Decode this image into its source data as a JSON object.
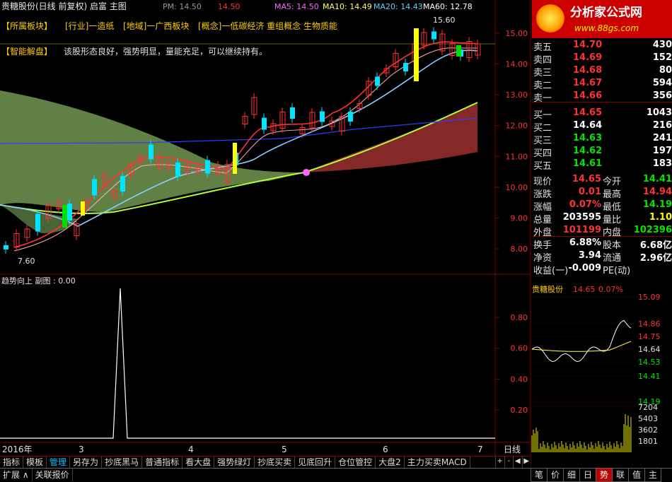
{
  "header": {
    "stock_title": "贵糖股份(日线 前复权) 启富 主图",
    "pm_label": "PM: 14.50",
    "pm_value": "14.50",
    "ma5": "MA5: 14.50",
    "ma10": "MA10: 14.49",
    "ma20": "MA20: 14.43",
    "ma60": "MA60: 12.78"
  },
  "sector_tags": [
    "【所属板块】",
    "[行业]一造纸",
    "[地域]一广西板块",
    "[概念]一低碳经济 重组概念 生物质能"
  ],
  "smart_analysis": {
    "label": "【智能解盘】",
    "text": "该股形态良好，强势明显，量能充足，可以继续持有。"
  },
  "chart_annotations": {
    "high_marker": "15.60",
    "low_marker": "7.60"
  },
  "price_axis": [
    "15.00",
    "14.00",
    "13.00",
    "12.00",
    "11.00",
    "10.00",
    "9.00",
    "8.00"
  ],
  "sub_chart": {
    "title": "趋势向上 副图 : 0.00",
    "axis": [
      "0.80",
      "0.60",
      "0.40",
      "0.20"
    ]
  },
  "date_axis": [
    "2016年",
    "3",
    "4",
    "5",
    "6",
    "7"
  ],
  "period_label": "日线",
  "logo": {
    "brand": "分析家公式网",
    "url": "www.88gs.com"
  },
  "order_book": {
    "asks": [
      {
        "label": "卖五",
        "price": "14.70",
        "vol": "430"
      },
      {
        "label": "卖四",
        "price": "14.69",
        "vol": "152"
      },
      {
        "label": "卖三",
        "price": "14.68",
        "vol": "80"
      },
      {
        "label": "卖二",
        "price": "14.67",
        "vol": "594"
      },
      {
        "label": "卖一",
        "price": "14.66",
        "vol": "356"
      }
    ],
    "bids": [
      {
        "label": "买一",
        "price": "14.65",
        "vol": "1043"
      },
      {
        "label": "买二",
        "price": "14.64",
        "vol": "216"
      },
      {
        "label": "买三",
        "price": "14.63",
        "vol": "241"
      },
      {
        "label": "买四",
        "price": "14.62",
        "vol": "197"
      },
      {
        "label": "买五",
        "price": "14.61",
        "vol": "183"
      }
    ]
  },
  "stats": [
    {
      "l1": "现价",
      "v1": "14.65",
      "l2": "今开",
      "v2": "14.41"
    },
    {
      "l1": "涨跌",
      "v1": "0.01",
      "l2": "最高",
      "v2": "14.94"
    },
    {
      "l1": "涨幅",
      "v1": "0.07%",
      "l2": "最低",
      "v2": "14.19"
    },
    {
      "l1": "总量",
      "v1": "203595",
      "l2": "量比",
      "v2": "1.10"
    },
    {
      "l1": "外盘",
      "v1": "101199",
      "l2": "内盘",
      "v2": "102396"
    },
    {
      "l1": "换手",
      "v1": "6.88%",
      "l2": "股本",
      "v2": "6.68亿"
    },
    {
      "l1": "净资",
      "v1": "3.94",
      "l2": "流通",
      "v2": "2.96亿"
    },
    {
      "l1": "收益(一)",
      "v1": "-0.009",
      "l2": "PE(动)",
      "v2": ""
    }
  ],
  "minute_chart": {
    "name": "贵糖股份",
    "price": "14.65",
    "pct": "0.07%",
    "price_axis": [
      "15.09",
      "14.86",
      "14.75",
      "14.64",
      "14.53",
      "14.41",
      "14.19"
    ],
    "vol_axis": [
      "7204",
      "5403",
      "3602",
      "1801"
    ]
  },
  "toolbar": [
    "指标",
    "模板",
    "管理",
    "另存为",
    "抄底黑马",
    "普通指标",
    "看大盘",
    "强势绿灯",
    "抄底买卖",
    "见底回升",
    "仓位管控",
    "大盘2",
    "主力买卖MACD"
  ],
  "toolbar_controls": [
    "+",
    "-",
    "◀",
    "▶"
  ],
  "status_bar": [
    "扩展 ∧",
    "关联报价"
  ],
  "right_tabs": [
    "笔",
    "价",
    "细",
    "日",
    "势",
    "联",
    "值",
    "主"
  ],
  "colors": {
    "up": "#ff3232",
    "down": "#00e5ff",
    "ask_price": "#ff3232",
    "bid_price": "#00e600",
    "ma5": "#ffffff",
    "ma10": "#ffff00",
    "ma20": "#ff00ff",
    "ma60": "#00ff00",
    "grid": "#800000",
    "cloud_green": "#6b8e4e",
    "cloud_red": "#8b2a2a"
  }
}
